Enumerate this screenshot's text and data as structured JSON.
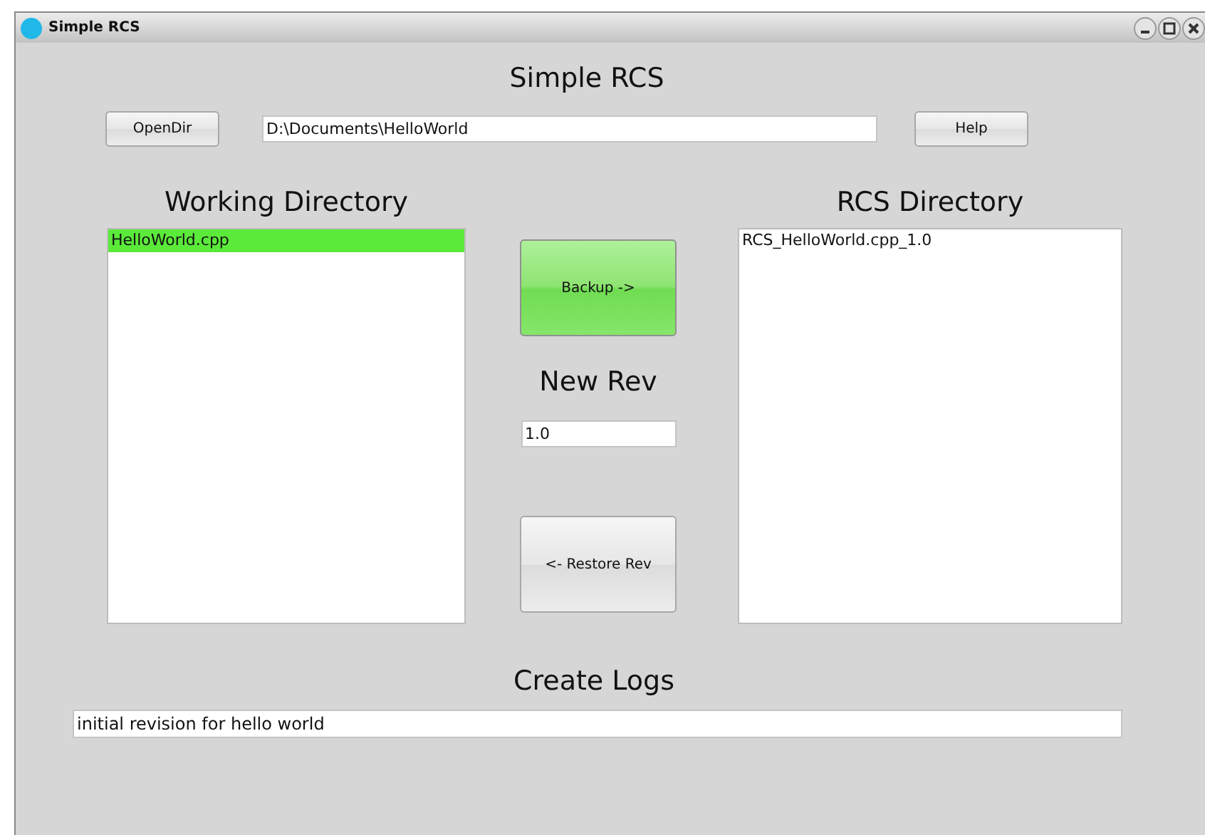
{
  "window": {
    "title": "Simple RCS"
  },
  "heading": "Simple RCS",
  "open_dir_button": "OpenDir",
  "path_field": {
    "value": "D:\\Documents\\HelloWorld"
  },
  "help_button": "Help",
  "working_directory": {
    "heading": "Working Directory",
    "items": [
      {
        "name": "HelloWorld.cpp",
        "selected": true
      }
    ]
  },
  "rcs_directory": {
    "heading": "RCS Directory",
    "items": [
      {
        "name": "RCS_HelloWorld.cpp_1.0",
        "selected": false
      }
    ]
  },
  "backup_button": "Backup ->",
  "new_rev": {
    "heading": "New Rev",
    "value": "1.0"
  },
  "restore_button": "<- Restore Rev",
  "create_logs": {
    "heading": "Create Logs",
    "value": "initial revision for hello world"
  }
}
